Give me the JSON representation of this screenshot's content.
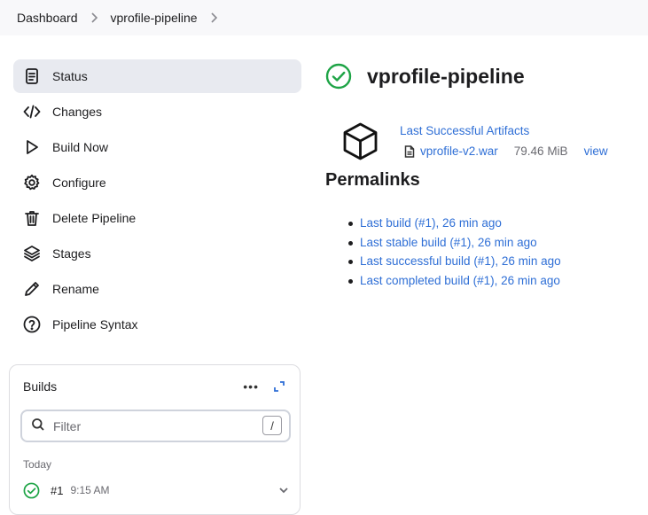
{
  "breadcrumb": [
    {
      "label": "Dashboard"
    },
    {
      "label": "vprofile-pipeline"
    }
  ],
  "sidebar": {
    "items": [
      {
        "label": "Status",
        "icon": "document-icon",
        "active": true
      },
      {
        "label": "Changes",
        "icon": "code-icon"
      },
      {
        "label": "Build Now",
        "icon": "play-icon"
      },
      {
        "label": "Configure",
        "icon": "gear-icon"
      },
      {
        "label": "Delete Pipeline",
        "icon": "trash-icon"
      },
      {
        "label": "Stages",
        "icon": "layers-icon"
      },
      {
        "label": "Rename",
        "icon": "pencil-icon"
      },
      {
        "label": "Pipeline Syntax",
        "icon": "help-circle-icon"
      }
    ]
  },
  "builds": {
    "title": "Builds",
    "more": "•••",
    "filter_placeholder": "Filter",
    "filter_shortcut": "/",
    "group_label": "Today",
    "items": [
      {
        "number": "#1",
        "time": "9:15 AM",
        "status": "success"
      }
    ]
  },
  "main": {
    "title": "vprofile-pipeline",
    "status": "success",
    "artifacts": {
      "title": "Last Successful Artifacts",
      "file_name": "vprofile-v2.war",
      "file_size": "79.46 MiB",
      "view_label": "view"
    },
    "permalinks_title": "Permalinks",
    "permalinks": [
      "Last build (#1), 26 min ago",
      "Last stable build (#1), 26 min ago",
      "Last successful build (#1), 26 min ago",
      "Last completed build (#1), 26 min ago"
    ]
  },
  "colors": {
    "accent": "#2f6fd6",
    "success": "#1ea446",
    "active_bg": "#e8eaf0"
  }
}
